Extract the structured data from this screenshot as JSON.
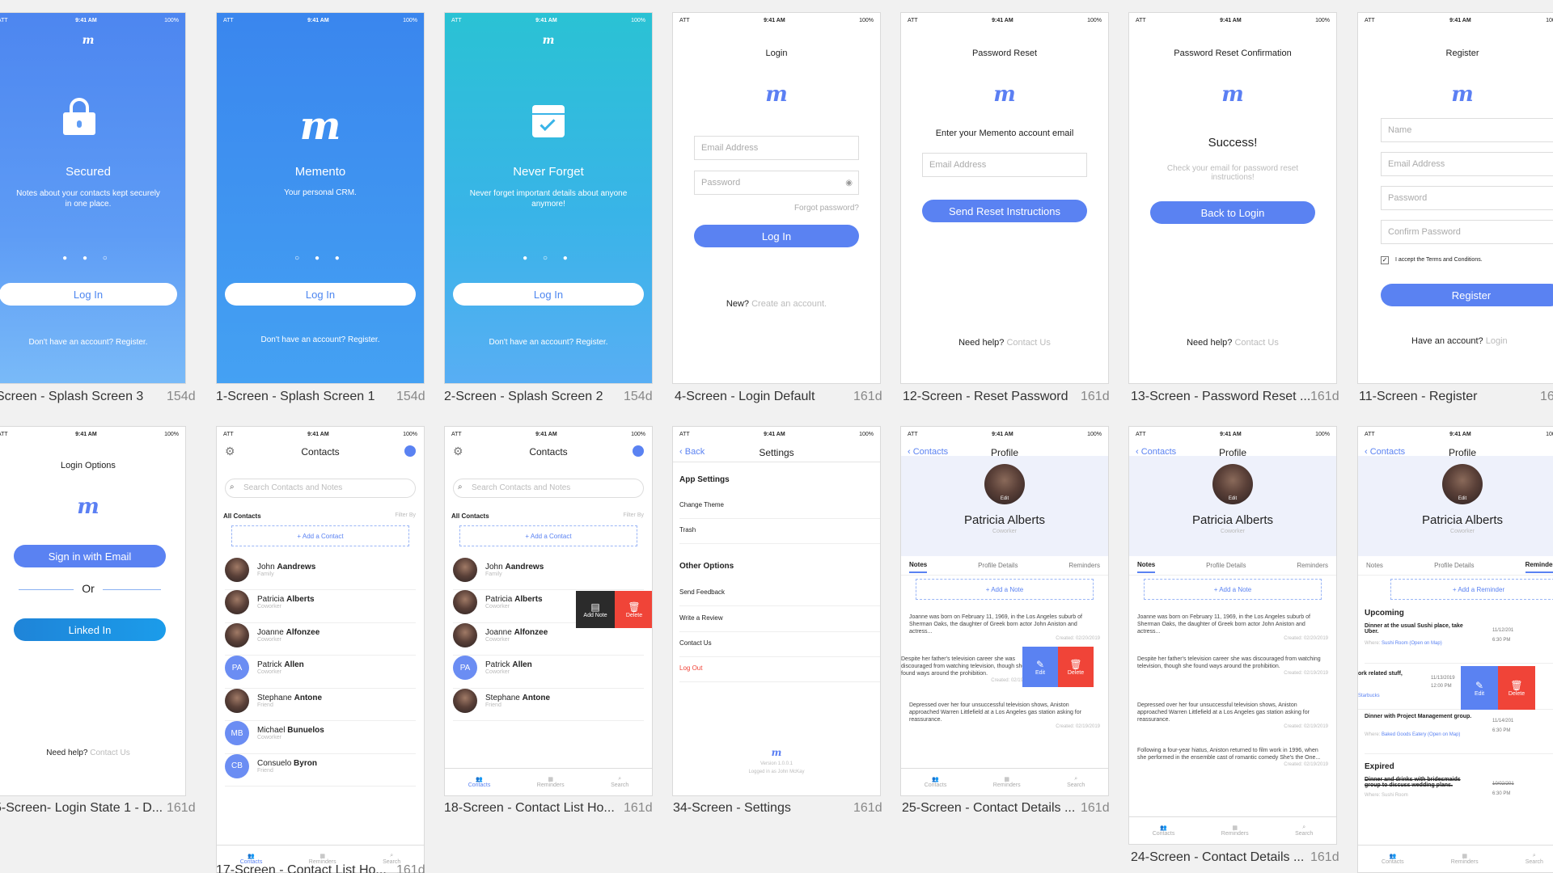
{
  "status": {
    "carrier": "ATT",
    "time": "9:41 AM",
    "battery": "100%"
  },
  "logo_letter": "m",
  "splash3": {
    "title": "Secured",
    "text": "Notes about your contacts kept securely in one place.",
    "button": "Log In",
    "footer": "Don't have an account? Register.",
    "caption": "Screen - Splash Screen 3",
    "size": "154d"
  },
  "splash1": {
    "title": "Memento",
    "text": "Your personal CRM.",
    "button": "Log In",
    "footer": "Don't have an account? Register.",
    "caption": "1-Screen - Splash Screen 1",
    "size": "154d"
  },
  "splash2": {
    "title": "Never Forget",
    "text": "Never forget important details about anyone anymore!",
    "button": "Log In",
    "footer": "Don't have an account? Register.",
    "caption": "2-Screen - Splash Screen 2",
    "size": "154d"
  },
  "login": {
    "title": "Login",
    "email_placeholder": "Email Address",
    "password_placeholder": "Password",
    "forgot": "Forgot password?",
    "button": "Log In",
    "new_prefix": "New?",
    "new_link": "Create an account.",
    "caption": "4-Screen - Login Default",
    "size": "161d"
  },
  "reset": {
    "title": "Password Reset",
    "prompt": "Enter your Memento account email",
    "email_placeholder": "Email Address",
    "button": "Send Reset Instructions",
    "help_prefix": "Need help?",
    "help_link": "Contact Us",
    "caption": "12-Screen - Reset Password",
    "size": "161d"
  },
  "resetconf": {
    "title": "Password Reset Confirmation",
    "heading": "Success!",
    "text": "Check your email for password reset instructions!",
    "button": "Back to Login",
    "help_prefix": "Need help?",
    "help_link": "Contact Us",
    "caption": "13-Screen - Password Reset ...",
    "size": "161d"
  },
  "register": {
    "title": "Register",
    "name_placeholder": "Name",
    "email_placeholder": "Email Address",
    "password_placeholder": "Password",
    "confirm_placeholder": "Confirm Password",
    "terms": "I accept the Terms and Conditions.",
    "button": "Register",
    "have_prefix": "Have an account?",
    "have_link": "Login",
    "caption": "11-Screen - Register",
    "size": "16"
  },
  "loginopts": {
    "title": "Login Options",
    "email_btn": "Sign in with Email",
    "or": "Or",
    "linkedin_btn": "Linked In",
    "help_prefix": "Need help?",
    "help_link": "Contact Us",
    "caption": "5-Screen- Login State 1 - D...",
    "size": "161d"
  },
  "contacts": {
    "title": "Contacts",
    "search_placeholder": "Search Contacts and Notes",
    "section": "All Contacts",
    "filter": "Filter By",
    "add": "+ Add a Contact",
    "list": [
      {
        "first": "John",
        "last": "Aandrews",
        "role": "Family"
      },
      {
        "first": "Patricia",
        "last": "Alberts",
        "role": "Coworker"
      },
      {
        "first": "Joanne",
        "last": "Alfonzee",
        "role": "Coworker"
      },
      {
        "first": "Patrick",
        "last": "Allen",
        "role": "Coworker",
        "initials": "PA"
      },
      {
        "first": "Stephane",
        "last": "Antone",
        "role": "Friend"
      },
      {
        "first": "Michael",
        "last": "Bunuelos",
        "role": "Coworker",
        "initials": "MB"
      },
      {
        "first": "Consuelo",
        "last": "Byron",
        "role": "Friend",
        "initials": "CB"
      }
    ],
    "tabs": [
      "Contacts",
      "Reminders",
      "Search"
    ],
    "caption17": "17-Screen - Contact List Ho...",
    "size17": "161d",
    "caption18": "18-Screen - Contact List Ho...",
    "size18": "161d",
    "swipe_note": "Add Note",
    "swipe_delete": "Delete"
  },
  "settings": {
    "back": "Back",
    "title": "Settings",
    "app_settings": "App Settings",
    "change_theme": "Change Theme",
    "trash": "Trash",
    "other": "Other Options",
    "feedback": "Send Feedback",
    "review": "Write a Review",
    "contact": "Contact Us",
    "logout": "Log Out",
    "version": "Version 1.0.0.1",
    "logged": "Logged in as John McKay",
    "caption": "34-Screen - Settings",
    "size": "161d"
  },
  "profile": {
    "back": "Contacts",
    "title": "Profile",
    "name": "Patricia Alberts",
    "role": "Coworker",
    "edit": "Edit",
    "tabs": [
      "Notes",
      "Profile Details",
      "Reminders"
    ],
    "add_note": "+ Add a Note",
    "add_reminder": "+ Add a Reminder",
    "notes": [
      {
        "text": "Joanne was born on February 11, 1969, in the Los Angeles suburb of Sherman Oaks, the daughter of Greek born actor John Aniston and actress...",
        "date": "Created: 02/20/2019"
      },
      {
        "text": "Despite her father's television career she was discouraged from watching television, though she found ways around the prohibition.",
        "date": "Created: 02/19/2019"
      },
      {
        "text": "Depressed over her four unsuccessful television shows, Aniston approached Warren Littlefield at a Los Angeles gas station asking for reassurance.",
        "date": "Created: 02/19/2019"
      },
      {
        "text": "Following a four-year hiatus, Aniston returned to film work in 1996, when she performed in the ensemble cast of romantic comedy She's the One...",
        "date": "Created: 02/19/2019"
      }
    ],
    "swipe_edit": "Edit",
    "swipe_delete": "Delete",
    "caption25": "25-Screen - Contact Details ...",
    "size25": "161d",
    "caption24": "24-Screen - Contact Details ...",
    "size24": "161d",
    "upcoming": "Upcoming",
    "expired": "Expired",
    "reminders": [
      {
        "title": "Dinner at the usual Sushi place, take Uber.",
        "where": "Where:",
        "place": "Sushi Room (Open on Map)",
        "date": "11/12/201",
        "time": "6:30 PM"
      },
      {
        "title": "ork related stuff,",
        "where": "",
        "place": "Starbucks",
        "date": "11/13/2019",
        "time": "12:00 PM"
      },
      {
        "title": "Dinner with Project Management group.",
        "where": "Where:",
        "place": "Baked Goods Eatery (Open on Map)",
        "date": "11/14/201",
        "time": "6:30 PM"
      },
      {
        "title": "Dinner and drinks with bridesmaids group to discuss wedding plans.",
        "where": "Where:",
        "place": "Sushi Room",
        "date": "10/02/201",
        "time": "6:30 PM"
      }
    ]
  },
  "colors": {
    "accent": "#5a82f2",
    "delete": "#f04438",
    "dark": "#2b2b2b"
  }
}
